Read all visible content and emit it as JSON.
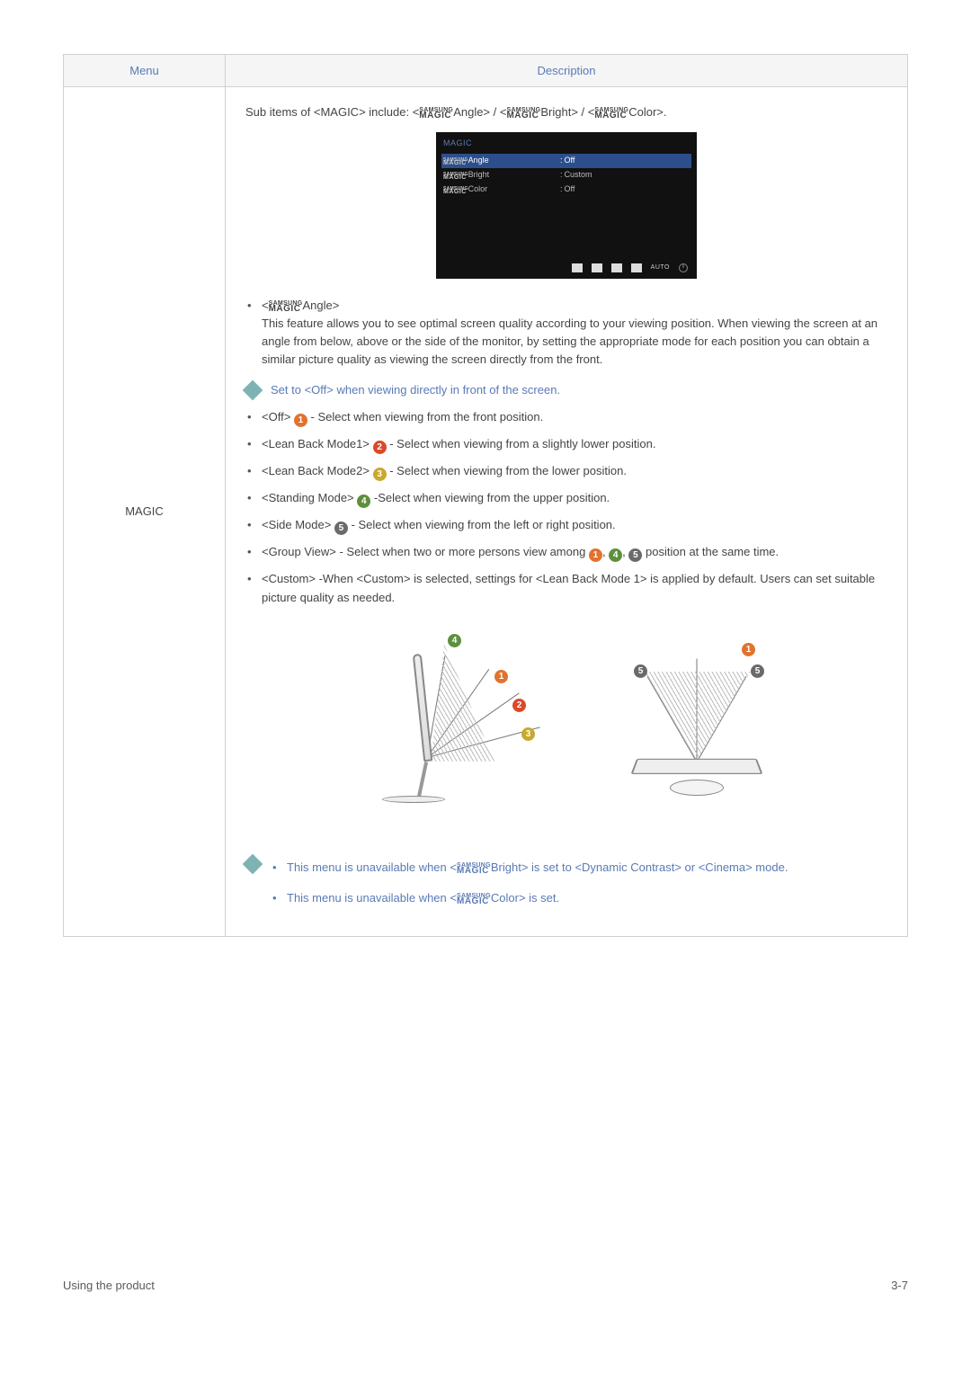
{
  "headers": {
    "menu": "Menu",
    "description": "Description"
  },
  "menu_label": "MAGIC",
  "intro": {
    "prefix": "Sub items of <MAGIC> include: <",
    "item1": "Angle> / <",
    "item2": "Bright> / <",
    "item3": "Color>."
  },
  "osd": {
    "title": "MAGIC",
    "rows": [
      {
        "label": "Angle",
        "value": "Off",
        "selected": true
      },
      {
        "label": "Bright",
        "value": "Custom",
        "selected": false
      },
      {
        "label": "Color",
        "value": "Off",
        "selected": false
      }
    ],
    "auto": "AUTO"
  },
  "samsung_magic": {
    "top": "SAMSUNG",
    "bot": "MAGIC"
  },
  "angle_heading_suffix": "Angle>",
  "angle_para": "This feature allows you to see optimal screen quality according to your viewing position. When viewing the screen at an angle from below, above or the side of the monitor, by setting the appropriate mode for each position you can obtain a similar picture quality as viewing the screen directly from the front.",
  "angle_note": "Set to <Off> when viewing directly in front of the screen.",
  "modes": {
    "off_pre": "<Off> ",
    "off_post": " - Select when viewing from the front position.",
    "lb1_pre": "<Lean Back Mode1> ",
    "lb1_post": " - Select when viewing from a slightly lower position.",
    "lb2_pre": "<Lean Back Mode2> ",
    "lb2_post": " - Select when viewing from the lower position.",
    "stand_pre": "<Standing Mode> ",
    "stand_post": " -Select when viewing from the upper position.",
    "side_pre": "<Side Mode> ",
    "side_post": " - Select when viewing from the left or right position.",
    "group_pre": "<Group View>  - Select when two or more persons view among ",
    "group_post": " position at the same time.",
    "sep": ", ",
    "custom": " <Custom> -When <Custom> is selected, settings for <Lean Back Mode 1> is applied by default. Users can set suitable picture quality as needed."
  },
  "nums": {
    "n1": "1",
    "n2": "2",
    "n3": "3",
    "n4": "4",
    "n5": "5"
  },
  "diag_nums": {
    "a4": "4",
    "a1": "1",
    "a2": "2",
    "a3": "3",
    "b1": "1",
    "b5l": "5",
    "b5r": "5"
  },
  "bottom_notes": {
    "n1_pre": "This menu is unavailable when <",
    "n1_mid": "Bright> is set to <Dynamic Contrast> or <Cinema> mode.",
    "n2_pre": "This menu is unavailable when <",
    "n2_post": "Color> is set."
  },
  "footer": {
    "left": "Using the product",
    "right": "3-7"
  }
}
